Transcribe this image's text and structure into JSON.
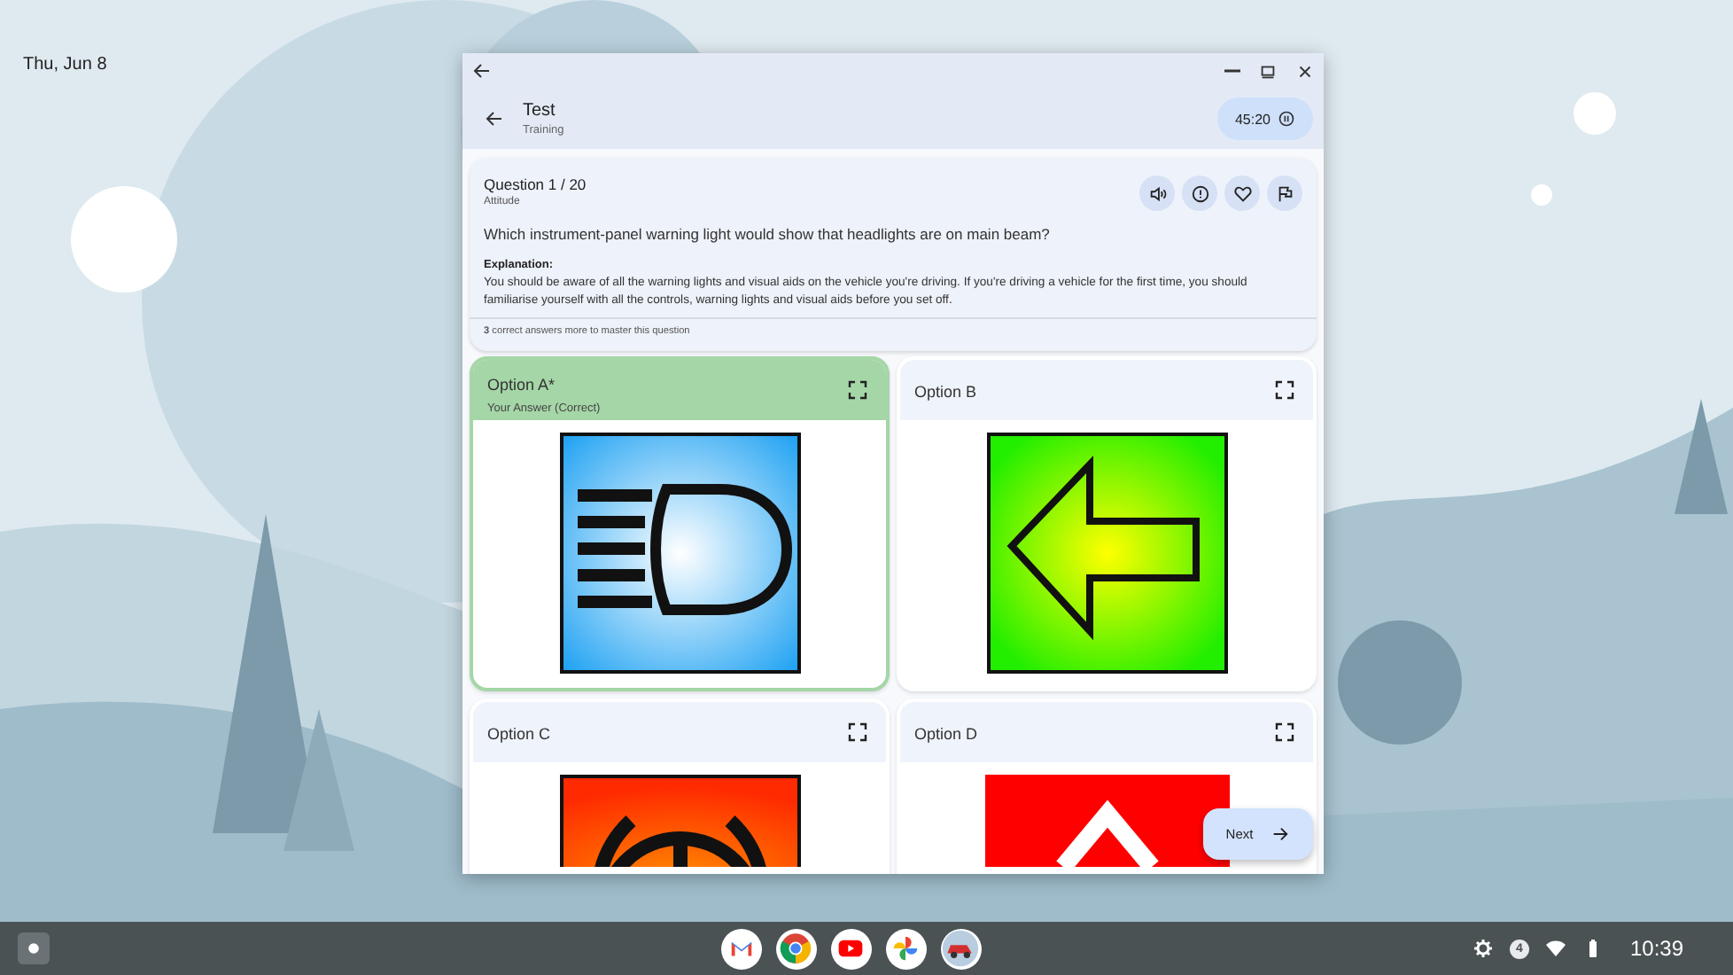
{
  "desktop": {
    "date": "Thu, Jun 8"
  },
  "window": {
    "title": "Test",
    "subtitle": "Training",
    "timer": "45:20"
  },
  "question": {
    "number": "Question 1 / 20",
    "category": "Attitude",
    "text": "Which instrument-panel warning light would show that headlights are on main beam?",
    "explanation_label": "Explanation:",
    "explanation": "You should be aware of all the warning lights and visual aids on the vehicle you're driving. If you're driving a vehicle for the first time, you should familiarise yourself with all the controls, warning lights and visual aids before you set off.",
    "mastery": "**3** correct answers more to master this question"
  },
  "options": [
    {
      "label": "Option A*",
      "note": "Your Answer (Correct)",
      "selected": true,
      "kind": "headlight"
    },
    {
      "label": "Option B",
      "selected": false,
      "kind": "arrow"
    },
    {
      "label": "Option C",
      "selected": false,
      "kind": "brake"
    },
    {
      "label": "Option D",
      "selected": false,
      "kind": "hazard"
    }
  ],
  "next_button": "Next",
  "shelf": {
    "notification_count": "4",
    "time": "10:39"
  }
}
